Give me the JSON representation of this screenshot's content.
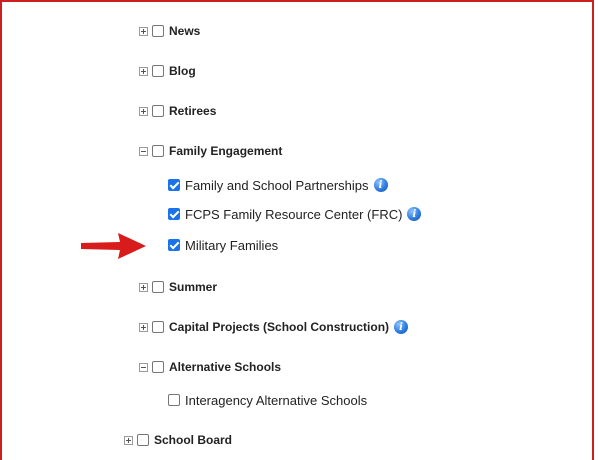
{
  "tree": {
    "news": {
      "label": "News"
    },
    "blog": {
      "label": "Blog"
    },
    "retirees": {
      "label": "Retirees"
    },
    "family_engagement": {
      "label": "Family Engagement"
    },
    "family_school_partnerships": {
      "label": "Family and School Partnerships"
    },
    "fcps_frc": {
      "label": "FCPS Family Resource Center (FRC)"
    },
    "military_families": {
      "label": "Military Families"
    },
    "summer": {
      "label": "Summer"
    },
    "capital_projects": {
      "label": "Capital Projects (School Construction)"
    },
    "alternative_schools": {
      "label": "Alternative Schools"
    },
    "interagency_alt_schools": {
      "label": "Interagency Alternative Schools"
    },
    "school_board": {
      "label": "School Board"
    }
  },
  "info_icon_glyph": "i",
  "colors": {
    "border": "#cc1f1f",
    "arrow": "#d81b1b",
    "checkbox": "#1a73e8"
  }
}
